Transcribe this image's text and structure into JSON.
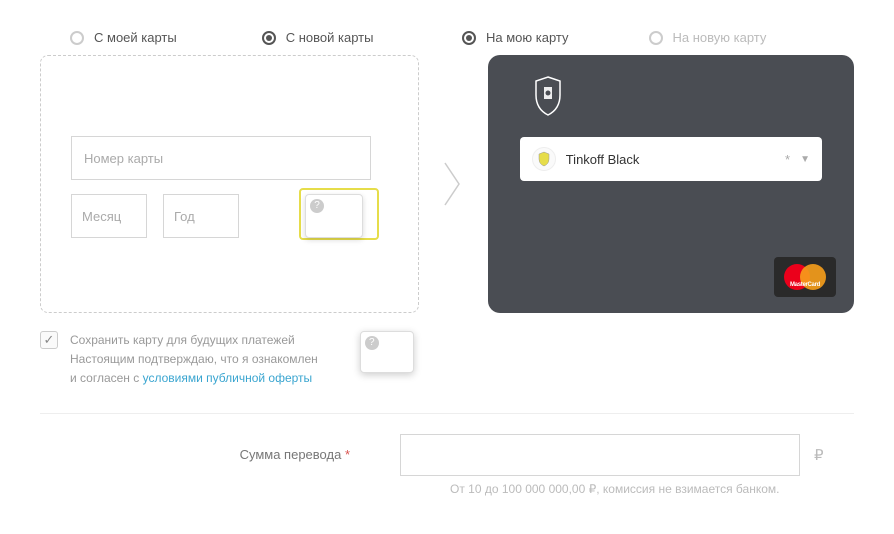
{
  "radios_from": {
    "my_card": "С моей карты",
    "new_card": "С новой карты"
  },
  "radios_to": {
    "my_card": "На мою карту",
    "new_card": "На новую карту"
  },
  "from_card": {
    "number_placeholder": "Номер карты",
    "month_placeholder": "Месяц",
    "year_placeholder": "Год",
    "cvv_help": "?"
  },
  "to_card": {
    "account_name": "Tinkoff Black",
    "account_mask": "*",
    "logo_text": "MasterCard"
  },
  "save": {
    "checked_symbol": "✓",
    "line1": "Сохранить карту для будущих платежей",
    "line2_a": "Настоящим подтверждаю, что я ознакомлен",
    "line2_b": "и согласен с ",
    "link": "условиями публичной оферты"
  },
  "amount": {
    "label": "Сумма перевода",
    "star": "*",
    "currency": "₽",
    "hint": "От 10 до 100 000 000,00 ₽, комиссия не взимается банком."
  },
  "help_q": "?"
}
